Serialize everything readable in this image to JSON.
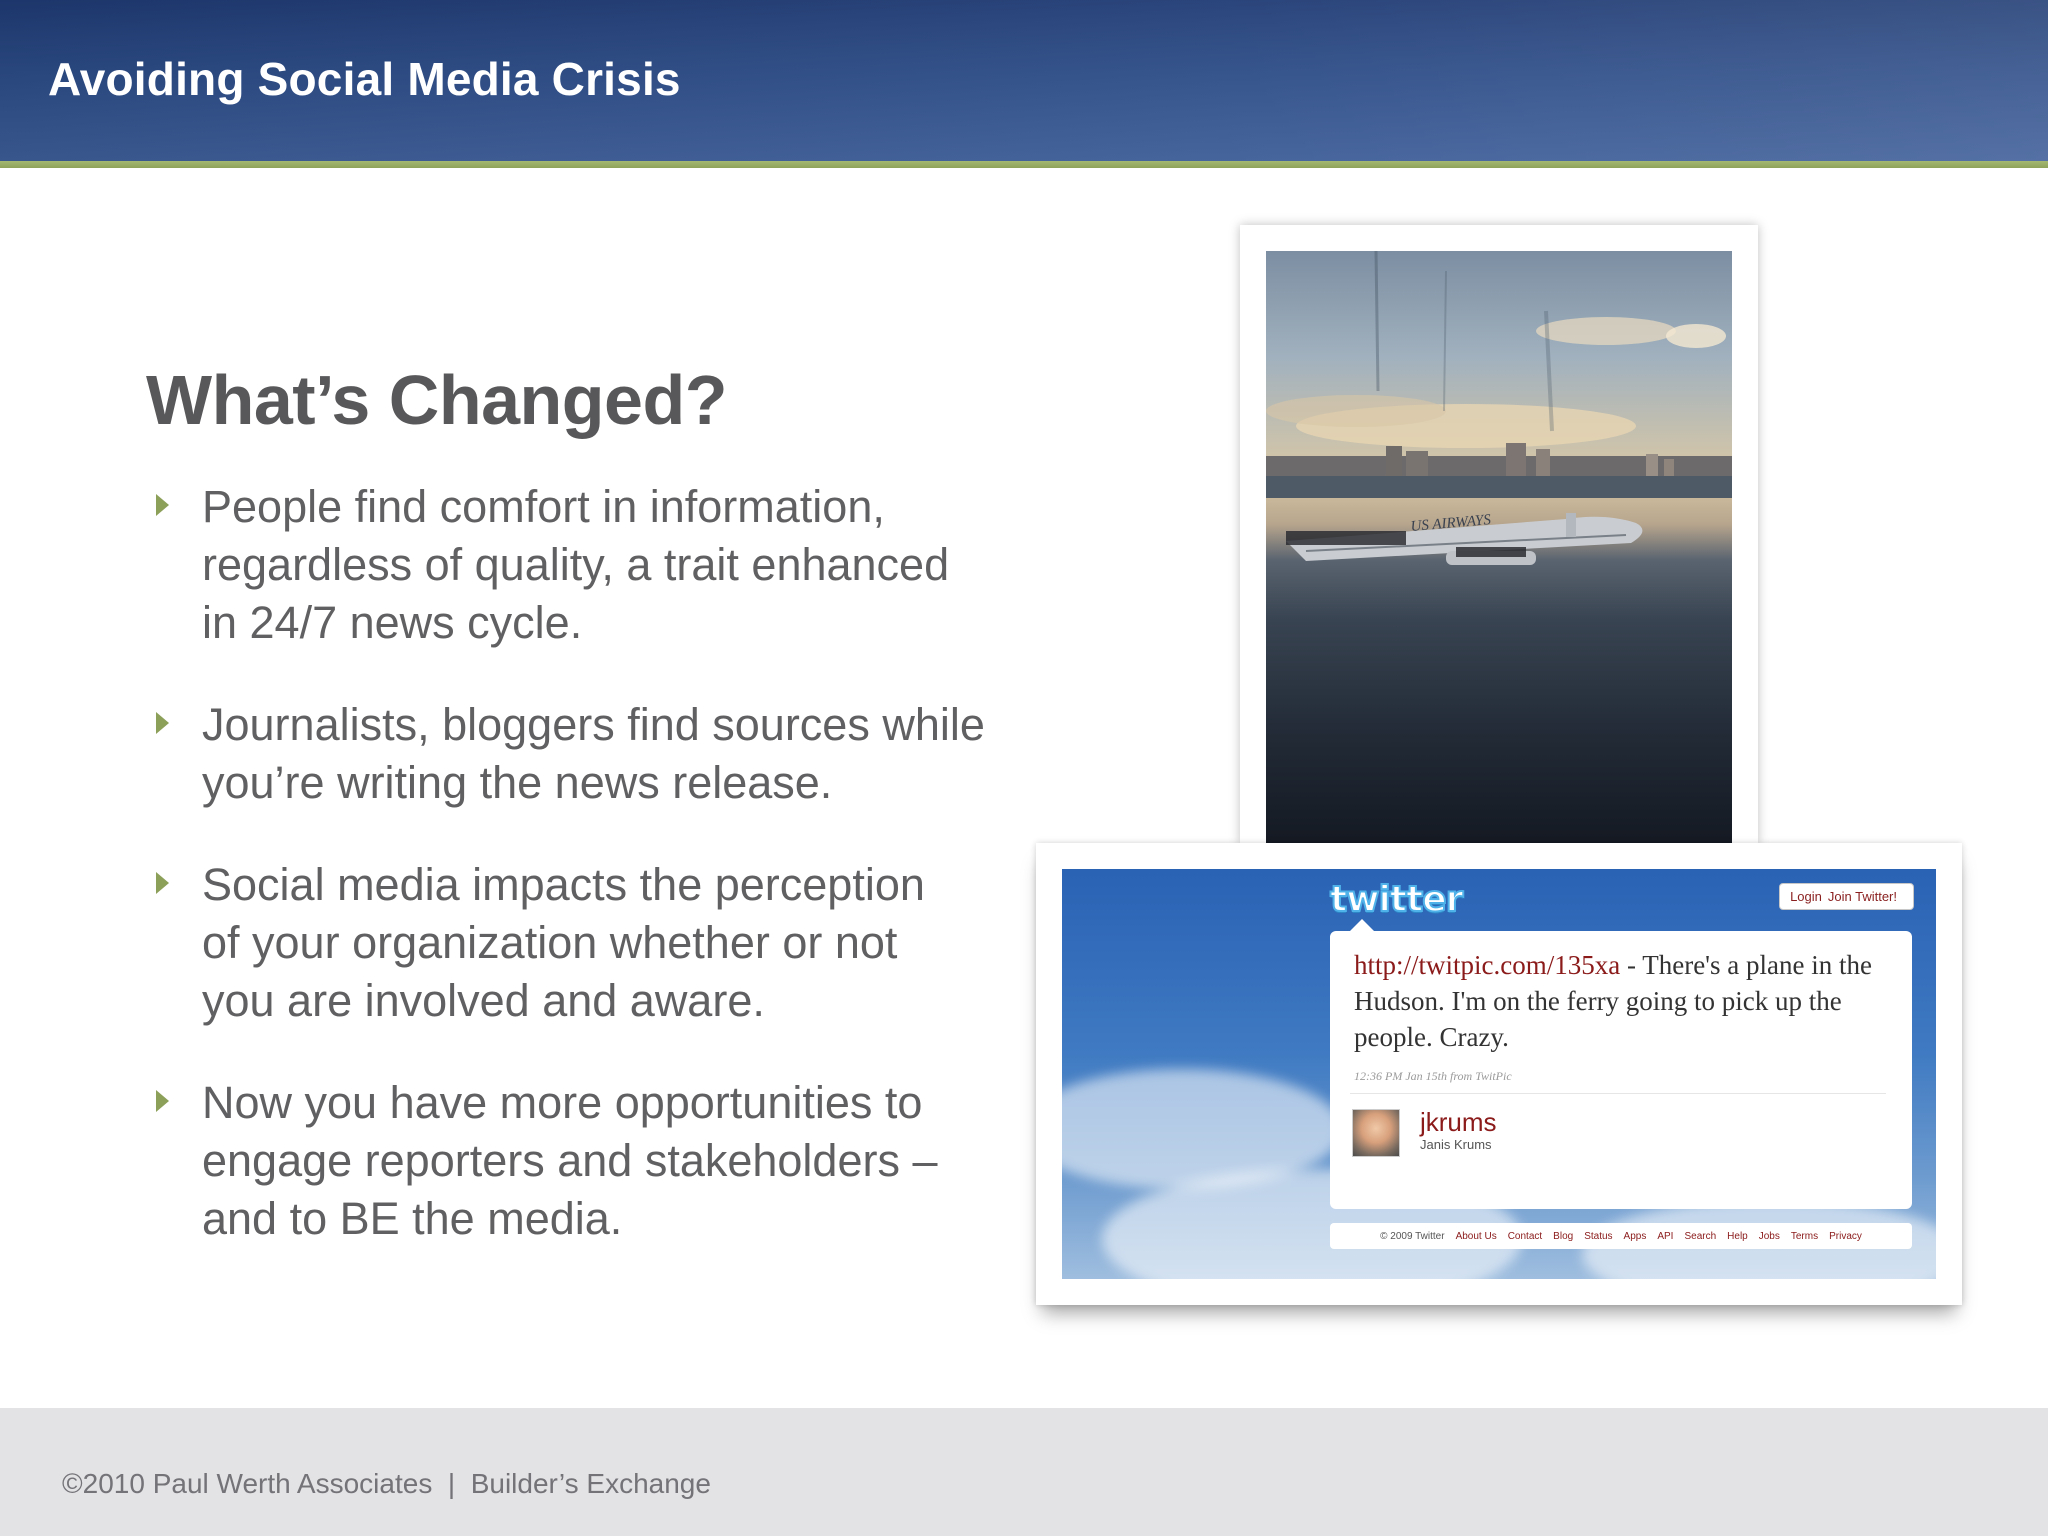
{
  "header": {
    "title": "Avoiding Social Media Crisis"
  },
  "slide": {
    "heading": "What’s Changed?",
    "bullets": [
      {
        "text": "People find comfort in information,\nregardless of quality, a trait enhanced\nin 24/7 news cycle."
      },
      {
        "text": "Journalists, bloggers find sources while\nyou’re writing the news release."
      },
      {
        "text": "Social media impacts the perception\nof your organization whether or not\nyou are involved and aware."
      },
      {
        "text": "Now you have more opportunities to\nengage reporters and stakeholders –\nand to BE the media."
      }
    ]
  },
  "photo": {
    "airline_text": "US AIRWAYS"
  },
  "tweet": {
    "logo": "twitter",
    "login": "Login",
    "join": "Join Twitter!",
    "link": "http://twitpic.com/135xa",
    "body": " - There's a plane in the Hudson. I'm on the ferry going to pick up the people. Crazy.",
    "meta": "12:36 PM Jan 15th from TwitPic",
    "username": "jkrums",
    "fullname": "Janis Krums",
    "footer_copy": "© 2009 Twitter",
    "footer_links": [
      "About Us",
      "Contact",
      "Blog",
      "Status",
      "Apps",
      "API",
      "Search",
      "Help",
      "Jobs",
      "Terms",
      "Privacy"
    ]
  },
  "footer": {
    "text": "©2010 Paul Werth Associates  |  Builder’s Exchange"
  },
  "colors": {
    "header_blue": "#2c4c87",
    "accent_green": "#8da05a",
    "text_gray": "#606062",
    "link_red": "#8b1a1a"
  }
}
